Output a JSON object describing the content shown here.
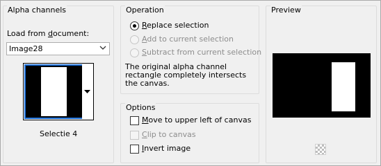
{
  "alpha": {
    "title": "Alpha channels",
    "load_label_pre": "Load from ",
    "load_label_accel": "d",
    "load_label_post": "ocument:",
    "document_value": "Image28",
    "selection_name": "Selectie 4"
  },
  "operation": {
    "title": "Operation",
    "options": [
      {
        "accel": "R",
        "rest": "eplace selection",
        "selected": true,
        "enabled": true
      },
      {
        "accel": "A",
        "rest": "dd to current selection",
        "selected": false,
        "enabled": false
      },
      {
        "accel": "S",
        "rest": "ubtract from current selection",
        "selected": false,
        "enabled": false
      }
    ],
    "note": "The original alpha channel rectangle completely intersects the canvas."
  },
  "options": {
    "title": "Options",
    "items": [
      {
        "accel": "M",
        "rest": "ove to upper left of canvas",
        "checked": false,
        "enabled": true
      },
      {
        "accel": "C",
        "rest": "lip to canvas",
        "checked": false,
        "enabled": false
      },
      {
        "accel": "I",
        "rest": "nvert image",
        "checked": false,
        "enabled": true
      }
    ]
  },
  "preview": {
    "title": "Preview"
  },
  "colors": {
    "selection_highlight": "#1a6ed8",
    "disabled_text": "#8d8d8d"
  }
}
